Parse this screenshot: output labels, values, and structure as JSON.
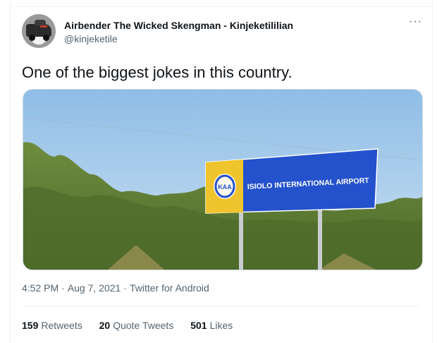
{
  "tweet": {
    "author_name": "Airbender The Wicked Skengman - Kinjeketililian",
    "author_handle": "@kinjeketile",
    "more_icon": "more-horizontal-icon",
    "text": "One of the biggest jokes in this country.",
    "image": {
      "sign_logo_text": "KAA",
      "sign_text": "ISIOLO INTERNATIONAL AIRPORT",
      "colors": {
        "sky": "#a9cde9",
        "sign_blue": "#1e4fc6",
        "sign_yellow": "#f0c42c",
        "bush": "#5c7a34"
      }
    },
    "time": "4:52 PM",
    "date": "Aug 7, 2021",
    "source": "Twitter for Android",
    "stats": [
      {
        "count": "159",
        "label": "Retweets"
      },
      {
        "count": "20",
        "label": "Quote Tweets"
      },
      {
        "count": "501",
        "label": "Likes"
      }
    ]
  }
}
